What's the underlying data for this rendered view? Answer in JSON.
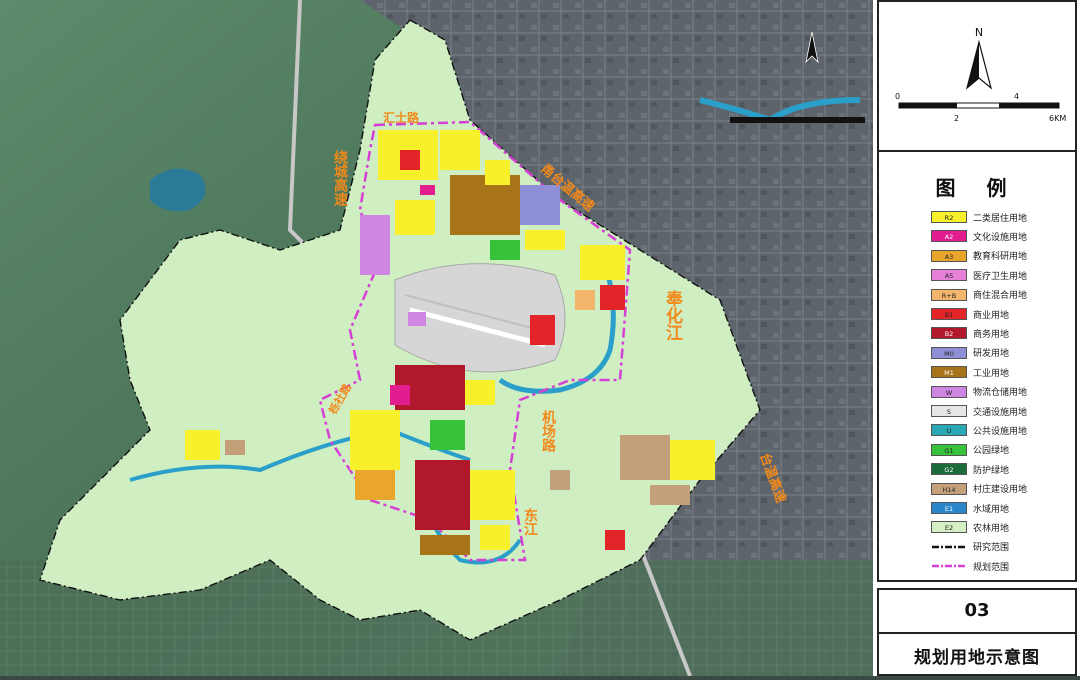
{
  "colors": {
    "background": "#ffffff",
    "hillshade": "#4f7a5e",
    "urban_satellite": "#59616a",
    "planning_base": "#cfefc2",
    "orange_label": "#f28a1b",
    "boundary": "#d63fd6",
    "river": "#2a9fc9"
  },
  "compass": {
    "north_label": "N"
  },
  "scale_bar": {
    "ticks": [
      "0",
      "2",
      "4",
      "6KM"
    ]
  },
  "legend": {
    "title": "图 例",
    "items": [
      {
        "code": "R2",
        "label": "二类居住用地",
        "color": "#f7f02a"
      },
      {
        "code": "A2",
        "label": "文化设施用地",
        "color": "#e21d8f"
      },
      {
        "code": "A3",
        "label": "教育科研用地",
        "color": "#e9a52c"
      },
      {
        "code": "A5",
        "label": "医疗卫生用地",
        "color": "#e67fd6"
      },
      {
        "code": "R+B",
        "label": "商住混合用地",
        "color": "#f3b56b"
      },
      {
        "code": "B1",
        "label": "商业用地",
        "color": "#e3252a"
      },
      {
        "code": "B2",
        "label": "商务用地",
        "color": "#b2182b"
      },
      {
        "code": "M0",
        "label": "研发用地",
        "color": "#8f8fd8"
      },
      {
        "code": "M1",
        "label": "工业用地",
        "color": "#a8741a"
      },
      {
        "code": "W",
        "label": "物流仓储用地",
        "color": "#cf86e2"
      },
      {
        "code": "S",
        "label": "交通设施用地",
        "color": "#e6e6e6"
      },
      {
        "code": "U",
        "label": "公共设施用地",
        "color": "#2aa7b5"
      },
      {
        "code": "G1",
        "label": "公园绿地",
        "color": "#37c23b"
      },
      {
        "code": "G2",
        "label": "防护绿地",
        "color": "#1d6b3a"
      },
      {
        "code": "H14",
        "label": "村庄建设用地",
        "color": "#c3a07a"
      },
      {
        "code": "E1",
        "label": "水域用地",
        "color": "#2b86c9"
      },
      {
        "code": "E2",
        "label": "农林用地",
        "color": "#d4efc3"
      }
    ],
    "lines": [
      {
        "label": "研究范围",
        "color": "#111111",
        "style": "dash-dot"
      },
      {
        "label": "规划范围",
        "color": "#d63fd6",
        "style": "dash-dot"
      }
    ]
  },
  "sheet": {
    "number": "03",
    "title": "规划用地示意图"
  },
  "map_labels": {
    "road_huishi": "汇士路",
    "highway_raocheng": "绕城高速",
    "highway_yongtai": "甬台温高速",
    "river_fenghua": "奉化江",
    "road_jichang": "机场路",
    "river_dong": "东江",
    "highway_taiyong": "台温高速",
    "road_west": "栎社路"
  }
}
